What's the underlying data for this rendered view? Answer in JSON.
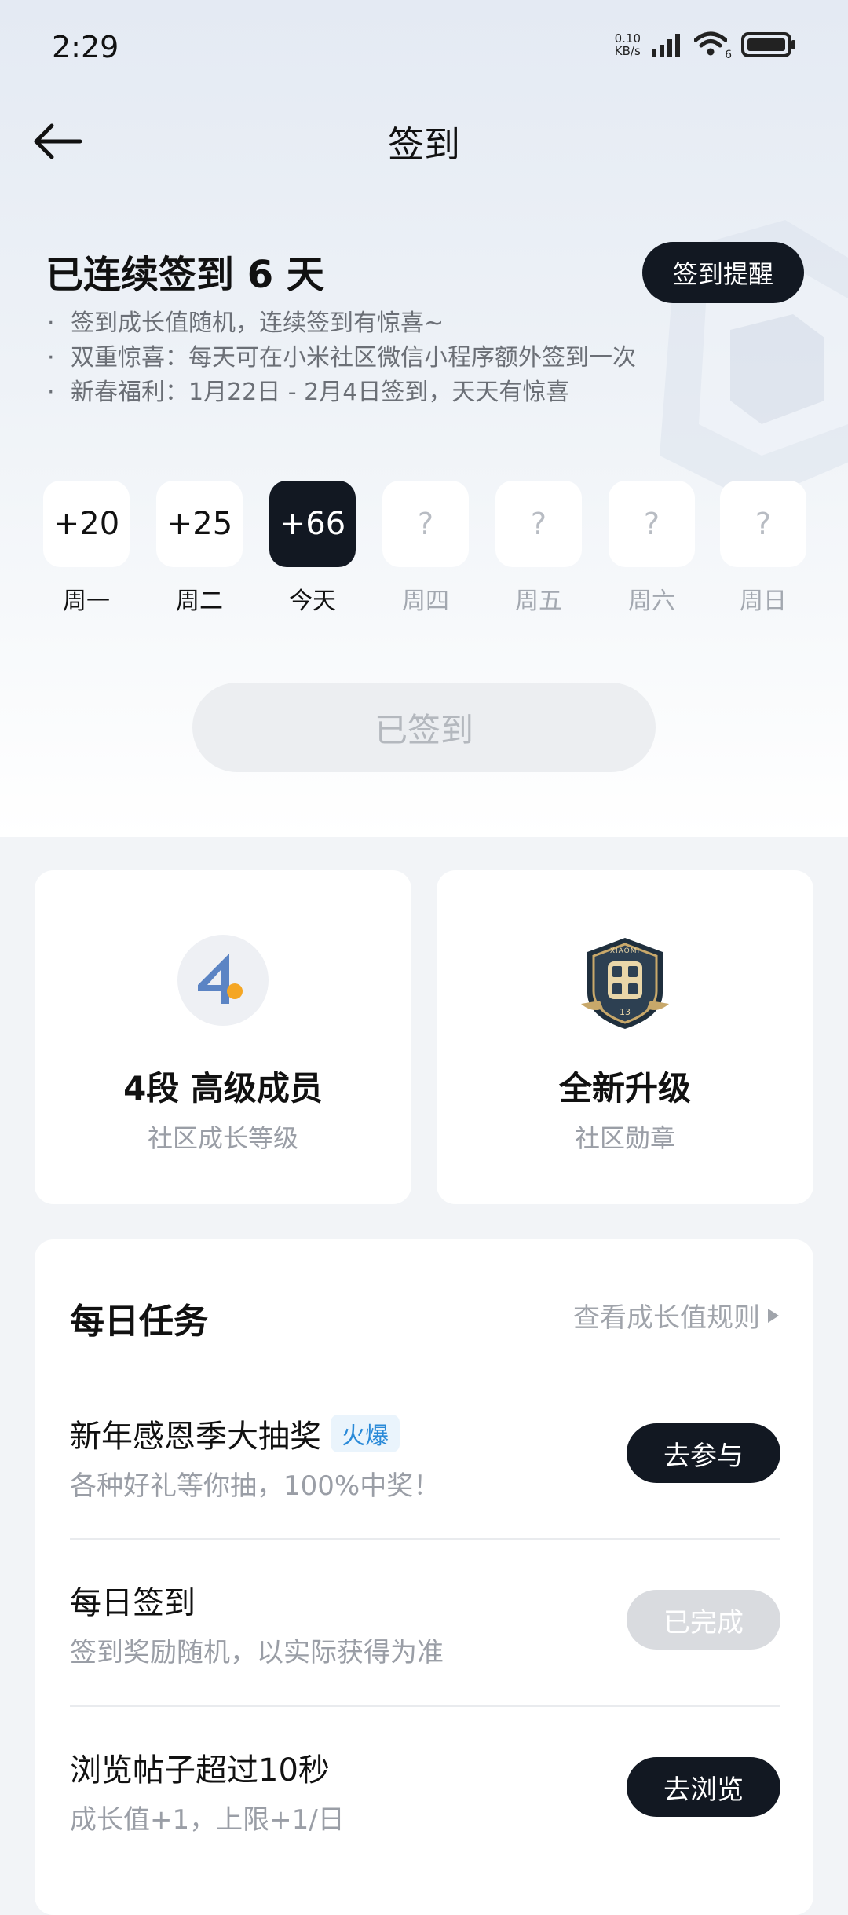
{
  "status_bar": {
    "time": "2:29",
    "net_speed_value": "0.10",
    "net_speed_unit": "KB/s",
    "wifi_badge": "6",
    "icons": [
      "signal-icon",
      "wifi-icon",
      "battery-icon"
    ]
  },
  "header": {
    "title": "签到",
    "back_icon": "arrow-left-icon"
  },
  "streak": {
    "title": "已连续签到 6 天",
    "remind_label": "签到提醒",
    "rules": [
      "签到成长值随机，连续签到有惊喜~",
      "双重惊喜：每天可在小米社区微信小程序额外签到一次",
      "新春福利：1月22日 - 2月4日签到，天天有惊喜"
    ]
  },
  "week": [
    {
      "value": "+20",
      "label": "周一",
      "state": "past"
    },
    {
      "value": "+25",
      "label": "周二",
      "state": "past"
    },
    {
      "value": "+66",
      "label": "今天",
      "state": "today"
    },
    {
      "value": "?",
      "label": "周四",
      "state": "future"
    },
    {
      "value": "?",
      "label": "周五",
      "state": "future"
    },
    {
      "value": "?",
      "label": "周六",
      "state": "future"
    },
    {
      "value": "?",
      "label": "周日",
      "state": "future"
    }
  ],
  "signed_button": "已签到",
  "level_card": {
    "icon_number": "4",
    "title": "4段 高级成员",
    "subtitle": "社区成长等级"
  },
  "badge_card": {
    "badge_text": "XIAOMI",
    "badge_number": "13",
    "title": "全新升级",
    "subtitle": "社区勋章"
  },
  "daily_tasks": {
    "title": "每日任务",
    "rules_link": "查看成长值规则",
    "items": [
      {
        "name": "新年感恩季大抽奖",
        "tag": "火爆",
        "desc": "各种好礼等你抽，100%中奖！",
        "button": "去参与",
        "state": "active"
      },
      {
        "name": "每日签到",
        "tag": "",
        "desc": "签到奖励随机，以实际获得为准",
        "button": "已完成",
        "state": "done"
      },
      {
        "name": "浏览帖子超过10秒",
        "tag": "",
        "desc": "成长值+1，上限+1/日",
        "button": "去浏览",
        "state": "active"
      }
    ]
  },
  "colors": {
    "primary_dark": "#121822",
    "hot_tag": "#2a8ad8",
    "level_blue": "#5b84c4",
    "level_orange": "#f5a623"
  }
}
